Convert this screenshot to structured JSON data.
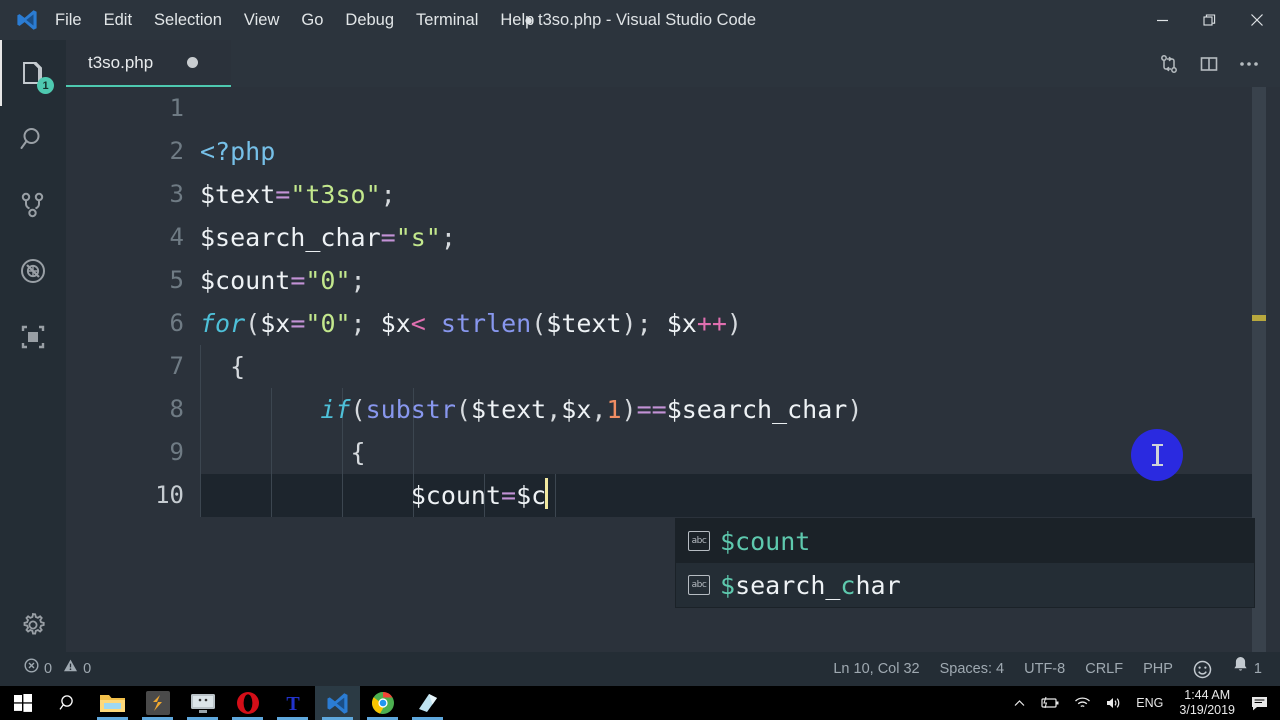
{
  "titlebar": {
    "logo_icon": "vscode-logo-icon",
    "menus": [
      "File",
      "Edit",
      "Selection",
      "View",
      "Go",
      "Debug",
      "Terminal",
      "Help"
    ],
    "window_title": "t3so.php - Visual Studio Code",
    "dirty_marker": "●",
    "minimize_icon": "minimize-icon",
    "maximize_icon": "restore-icon",
    "close_icon": "close-icon"
  },
  "activitybar": {
    "items": [
      {
        "name": "explorer",
        "icon": "files-icon",
        "badge": "1",
        "active": true
      },
      {
        "name": "search",
        "icon": "search-icon",
        "badge": "",
        "active": false
      },
      {
        "name": "source-control",
        "icon": "source-control-icon",
        "badge": "",
        "active": false
      },
      {
        "name": "debug",
        "icon": "debug-no-entry-icon",
        "badge": "",
        "active": false
      },
      {
        "name": "extensions",
        "icon": "extensions-icon",
        "badge": "",
        "active": false
      }
    ],
    "settings_icon": "gear-icon"
  },
  "tabs": {
    "items": [
      {
        "label": "t3so.php",
        "dirty": true,
        "active": true
      }
    ],
    "actions": [
      {
        "name": "compare-changes",
        "icon": "compare-changes-icon"
      },
      {
        "name": "split-editor",
        "icon": "split-editor-icon"
      },
      {
        "name": "more-actions",
        "icon": "ellipsis-icon"
      }
    ]
  },
  "editor": {
    "language": "php",
    "active_line": 10,
    "lines": [
      {
        "n": "1",
        "tokens": []
      },
      {
        "n": "2",
        "tokens": [
          {
            "t": "tag",
            "v": "<?php"
          }
        ]
      },
      {
        "n": "3",
        "tokens": [
          {
            "t": "var",
            "v": "$text"
          },
          {
            "t": "op",
            "v": "="
          },
          {
            "t": "str",
            "v": "\"t3so\""
          },
          {
            "t": "punct",
            "v": ";"
          }
        ]
      },
      {
        "n": "4",
        "tokens": [
          {
            "t": "var",
            "v": "$search_char"
          },
          {
            "t": "op",
            "v": "="
          },
          {
            "t": "str",
            "v": "\"s\""
          },
          {
            "t": "punct",
            "v": ";"
          }
        ]
      },
      {
        "n": "5",
        "tokens": [
          {
            "t": "var",
            "v": "$count"
          },
          {
            "t": "op",
            "v": "="
          },
          {
            "t": "str",
            "v": "\"0\""
          },
          {
            "t": "punct",
            "v": ";"
          }
        ]
      },
      {
        "n": "6",
        "tokens": [
          {
            "t": "kw",
            "v": "for"
          },
          {
            "t": "paren",
            "v": "("
          },
          {
            "t": "var",
            "v": "$x"
          },
          {
            "t": "op",
            "v": "="
          },
          {
            "t": "str",
            "v": "\"0\""
          },
          {
            "t": "punct",
            "v": "; "
          },
          {
            "t": "var",
            "v": "$x"
          },
          {
            "t": "pink",
            "v": "<"
          },
          {
            "t": "var",
            "v": " "
          },
          {
            "t": "fn",
            "v": "strlen"
          },
          {
            "t": "paren",
            "v": "("
          },
          {
            "t": "var",
            "v": "$text"
          },
          {
            "t": "paren",
            "v": ")"
          },
          {
            "t": "punct",
            "v": "; "
          },
          {
            "t": "var",
            "v": "$x"
          },
          {
            "t": "pink",
            "v": "++"
          },
          {
            "t": "paren",
            "v": ")"
          }
        ]
      },
      {
        "n": "7",
        "tokens": [
          {
            "t": "punct",
            "v": "  {"
          }
        ]
      },
      {
        "n": "8",
        "tokens": [
          {
            "t": "var",
            "v": "        "
          },
          {
            "t": "kw",
            "v": "if"
          },
          {
            "t": "paren",
            "v": "("
          },
          {
            "t": "fn",
            "v": "substr"
          },
          {
            "t": "paren",
            "v": "("
          },
          {
            "t": "var",
            "v": "$text"
          },
          {
            "t": "punct",
            "v": ","
          },
          {
            "t": "var",
            "v": "$x"
          },
          {
            "t": "punct",
            "v": ","
          },
          {
            "t": "num",
            "v": "1"
          },
          {
            "t": "paren",
            "v": ")"
          },
          {
            "t": "op",
            "v": "=="
          },
          {
            "t": "var",
            "v": "$search_char"
          },
          {
            "t": "paren",
            "v": ")"
          }
        ]
      },
      {
        "n": "9",
        "tokens": [
          {
            "t": "punct",
            "v": "          {"
          }
        ]
      },
      {
        "n": "10",
        "tokens": [
          {
            "t": "var",
            "v": "              $count"
          },
          {
            "t": "op",
            "v": "="
          },
          {
            "t": "var",
            "v": "$c"
          }
        ]
      }
    ]
  },
  "suggest": {
    "items": [
      {
        "icon_label": "abc",
        "icon": "word-suggestion-icon",
        "match": "$c",
        "rest": "ount",
        "selected": true
      },
      {
        "icon_label": "abc",
        "icon": "word-suggestion-icon",
        "match": "$",
        "mid": "search_",
        "match2": "c",
        "rest": "har",
        "selected": false
      }
    ]
  },
  "statusbar": {
    "errors_icon": "error-circle-icon",
    "errors": "0",
    "warnings_icon": "warning-triangle-icon",
    "warnings": "0",
    "position": "Ln 10, Col 32",
    "indentation": "Spaces: 4",
    "encoding": "UTF-8",
    "eol": "CRLF",
    "language": "PHP",
    "feedback_icon": "smiley-icon",
    "notifications_icon": "bell-icon",
    "notifications_count": "1"
  },
  "taskbar": {
    "start_icon": "windows-start-icon",
    "search_icon": "search-icon",
    "apps": [
      {
        "name": "file-explorer",
        "icon": "folder-icon",
        "color": "#f2b83c",
        "running": true,
        "active": false
      },
      {
        "name": "sublime-text",
        "icon": "sublime-icon",
        "color": "#4a4a4a",
        "running": true,
        "active": false
      },
      {
        "name": "unknown-app",
        "icon": "monitor-icon",
        "color": "#9fa8ad",
        "running": true,
        "active": false
      },
      {
        "name": "opera",
        "icon": "opera-icon",
        "color": "#d40e18",
        "running": true,
        "active": false
      },
      {
        "name": "t-app",
        "icon": "t-icon",
        "color": "#2233cc",
        "running": true,
        "active": false
      },
      {
        "name": "visual-studio-code",
        "icon": "vscode-icon",
        "color": "#2b7cd3",
        "running": true,
        "active": true
      },
      {
        "name": "google-chrome",
        "icon": "chrome-icon",
        "color": "#4caf50",
        "running": true,
        "active": false
      },
      {
        "name": "notes-app",
        "icon": "notes-icon",
        "color": "#b8e0ef",
        "running": true,
        "active": false
      }
    ],
    "tray": {
      "chevron_icon": "chevron-up-icon",
      "battery_icon": "battery-icon",
      "wifi_icon": "wifi-icon",
      "volume_icon": "volume-icon",
      "language": "ENG",
      "time": "1:44 AM",
      "date": "3/19/2019",
      "action_center_icon": "action-center-icon"
    }
  },
  "colors": {
    "titlebar_bg": "#2c343d",
    "editor_bg": "#2b323b",
    "activitybar_bg": "#242d35",
    "statusbar_bg": "#242d35",
    "accent_teal": "#4ec9b0",
    "cursor": "#f2e9a0",
    "mouse_highlight": "#2a2ae0"
  }
}
